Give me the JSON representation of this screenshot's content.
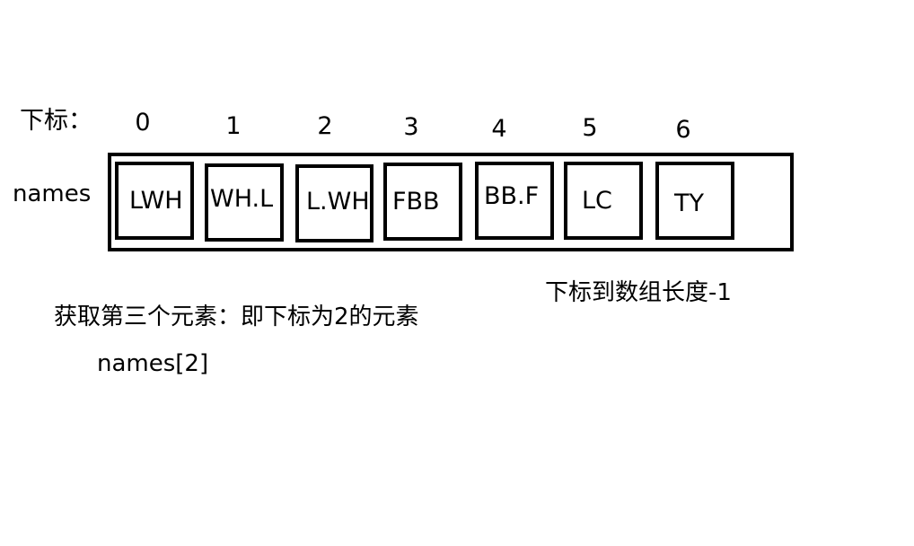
{
  "diagram": {
    "index_label": "下标：",
    "array_label": "names",
    "indices": [
      "0",
      "1",
      "2",
      "3",
      "4",
      "5",
      "6"
    ],
    "elements": [
      "LWH",
      "WH.L",
      "L.WH",
      "FBB",
      "BB.F",
      "LC",
      "TY"
    ],
    "note_third_element": "获取第三个元素：即下标为2的元素",
    "note_index_range": "下标到数组长度-1",
    "code_expression": "names[2]"
  }
}
